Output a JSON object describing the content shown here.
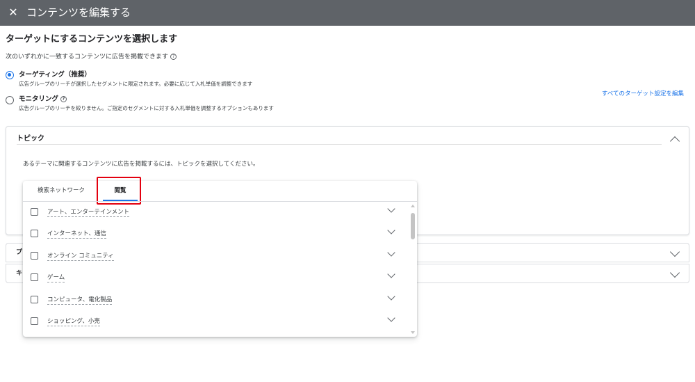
{
  "header": {
    "close_icon": "close-icon",
    "title": "コンテンツを編集する"
  },
  "content": {
    "heading": "ターゲットにするコンテンツを選択します",
    "subheading": "次のいずれかに一致するコンテンツに広告を掲載できます",
    "help_icon": "help-circle-icon"
  },
  "options": [
    {
      "title": "ターゲティング（推奨）",
      "description": "広告グループのリーチが選択したセグメントに限定されます。必要に応じて入札単価を調整できます",
      "selected": true
    },
    {
      "title": "モニタリング",
      "description": "広告グループのリーチを絞りません。ご指定のセグメントに対する入札単価を調整するオプションもあります",
      "selected": false
    }
  ],
  "edit_link": "すべてのターゲット設定を編集",
  "topic_section": {
    "title": "トピック",
    "instruction": "あるテーマに関連するコンテンツに広告を掲載するには、トピックを選択してください。",
    "collapse_icon": "chevron-up-icon"
  },
  "collapsed_sections": [
    {
      "label": "プ"
    },
    {
      "label": "キ"
    }
  ],
  "topic_panel": {
    "tabs": [
      {
        "label": "検索ネットワーク",
        "active": false
      },
      {
        "label": "閲覧",
        "active": true
      }
    ],
    "items": [
      {
        "label": "アート、エンターテインメント",
        "checked": false
      },
      {
        "label": "インターネット、通信",
        "checked": false
      },
      {
        "label": "オンライン コミュニティ",
        "checked": false
      },
      {
        "label": "ゲーム",
        "checked": false
      },
      {
        "label": "コンピュータ、電化製品",
        "checked": false
      },
      {
        "label": "ショッピング、小売",
        "checked": false
      }
    ]
  },
  "colors": {
    "header_bg": "#5f6368",
    "accent": "#1a73e8",
    "highlight": "#e3000f"
  }
}
